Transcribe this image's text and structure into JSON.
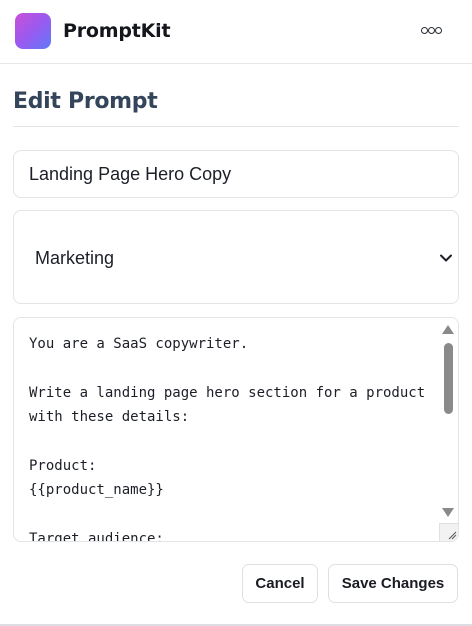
{
  "app": {
    "name": "PromptKit"
  },
  "header": {
    "menu_icon": "more-horizontal-icon"
  },
  "page": {
    "title": "Edit Prompt"
  },
  "form": {
    "name": {
      "value": "Landing Page Hero Copy"
    },
    "category": {
      "selected": "Marketing"
    },
    "template": {
      "value": "You are a SaaS copywriter.\n\nWrite a landing page hero section for a product with these details:\n\nProduct:\n{{product_name}}\n\nTarget audience:\n"
    }
  },
  "actions": {
    "cancel_label": "Cancel",
    "save_label": "Save Changes"
  },
  "colors": {
    "brand_gradient_start": "#c94fd6",
    "brand_gradient_end": "#5f7af8",
    "title": "#34445a"
  }
}
